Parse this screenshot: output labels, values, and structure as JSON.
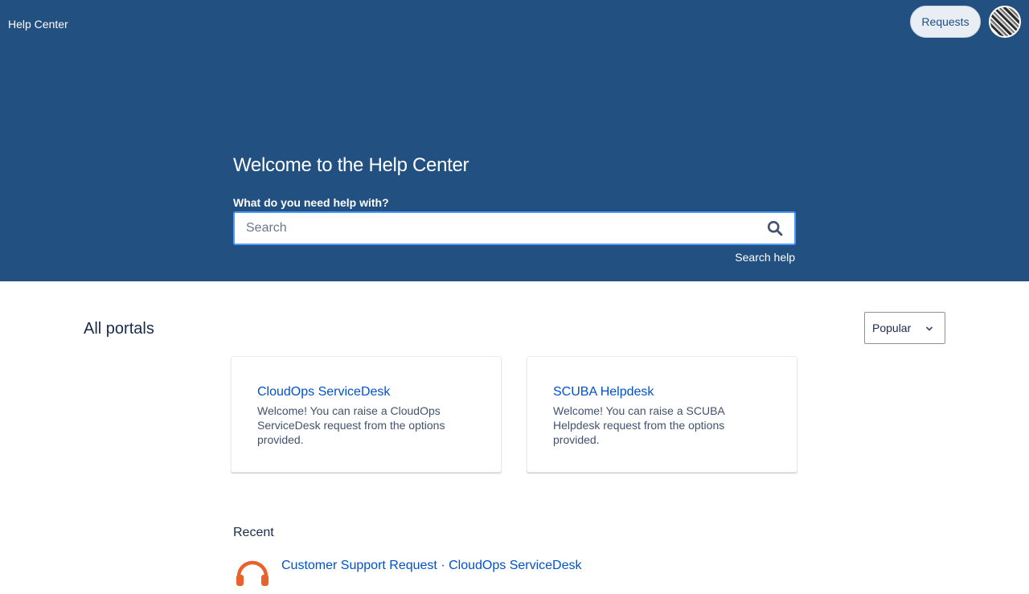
{
  "header": {
    "brand": "Help Center",
    "requests_label": "Requests"
  },
  "hero": {
    "title": "Welcome to the Help Center",
    "search_label": "What do you need help with?",
    "search_placeholder": "Search",
    "search_help": "Search help"
  },
  "portals": {
    "section_title": "All portals",
    "sort_selected": "Popular",
    "items": [
      {
        "title": "CloudOps ServiceDesk",
        "description": "Welcome! You can raise a CloudOps ServiceDesk request from the options provided."
      },
      {
        "title": "SCUBA Helpdesk",
        "description": "Welcome! You can raise a SCUBA Helpdesk request from the options provided."
      }
    ]
  },
  "recent": {
    "section_title": "Recent",
    "items": [
      {
        "label": "Customer Support Request · CloudOps ServiceDesk",
        "icon": "headset-icon"
      }
    ]
  },
  "colors": {
    "hero_background": "#215081",
    "link": "#0052cc",
    "search_focus_border": "#4c9aff",
    "recent_icon": "#e8632c"
  }
}
